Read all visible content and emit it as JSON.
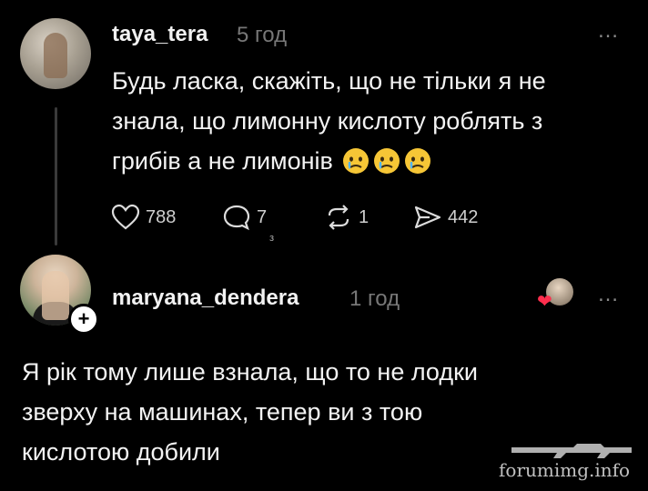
{
  "post": {
    "username": "taya_tera",
    "time": "5 год",
    "more": "…",
    "lines": [
      "Будь ласка, скажіть, що не тільки я не",
      "знала, що лимонну кислоту роблять з",
      "грибів а не лимонів"
    ],
    "emojis": [
      "crying-face-emoji",
      "crying-face-emoji",
      "crying-face-emoji"
    ],
    "actions": {
      "likes": "788",
      "comments": "7",
      "reposts": "1",
      "shares": "442"
    },
    "comments_sub": "з"
  },
  "reply": {
    "username": "maryana_dendera",
    "time": "1 год",
    "more": "…",
    "lines": [
      "Я рік тому лише взнала, що то не лодки",
      "зверху на машинах, тепер ви з тою",
      "кислотою добили"
    ],
    "follow_symbol": "+"
  },
  "watermark": "forumimg.info",
  "colors": {
    "background": "#000000",
    "text": "#f3f3f3",
    "muted": "#777777",
    "heart": "#ff2e4d"
  }
}
